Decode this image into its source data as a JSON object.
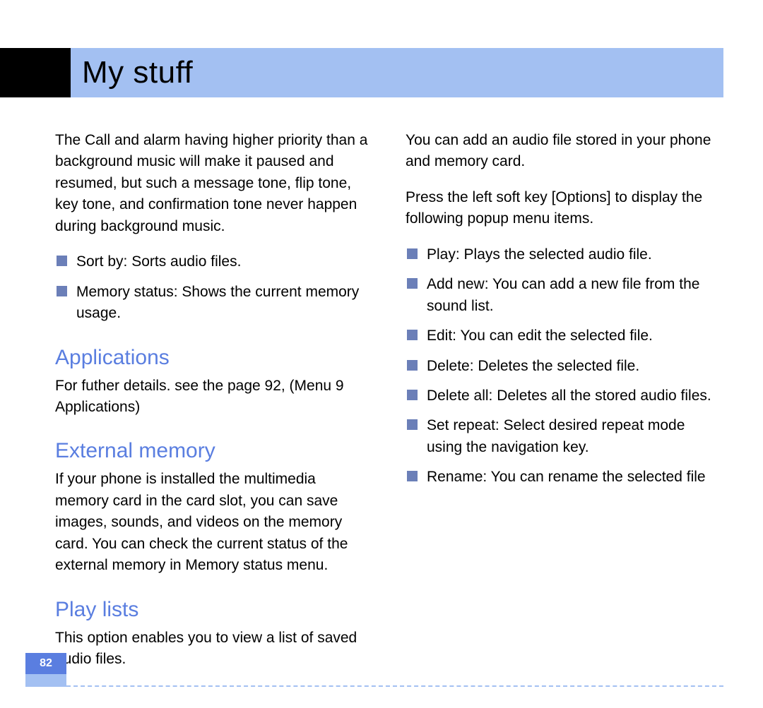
{
  "header": {
    "title": "My stuff"
  },
  "left_column": {
    "intro_paragraph": "The Call and alarm having higher priority than a background music will make it paused and resumed, but such a message tone, flip tone, key tone, and confirmation tone never happen during background music.",
    "bullets_a": [
      "Sort by: Sorts audio files.",
      "Memory status: Shows the current memory usage."
    ],
    "section_applications": {
      "heading": "Applications",
      "body": "For futher details. see the page 92, (Menu 9 Applications)"
    },
    "section_external_memory": {
      "heading": "External memory",
      "body": "If your phone is installed the multimedia memory card in the card slot, you can save images, sounds, and videos on the memory card. You can check the current status of the external memory in Memory status menu."
    },
    "section_play_lists": {
      "heading": "Play lists",
      "body": "This option enables you to view a list of saved audio files."
    }
  },
  "right_column": {
    "paragraph_1": "You can add an audio file stored in your phone and memory card.",
    "paragraph_2": "Press the left soft key [Options] to display the following popup menu items.",
    "bullets": [
      "Play: Plays the selected audio file.",
      "Add new: You can add a new file from the sound list.",
      "Edit: You can edit the selected file.",
      "Delete: Deletes the selected file.",
      "Delete all: Deletes all the stored audio files.",
      "Set repeat: Select desired repeat mode using the navigation key.",
      "Rename: You can rename the selected file"
    ]
  },
  "footer": {
    "page_number": "82"
  }
}
